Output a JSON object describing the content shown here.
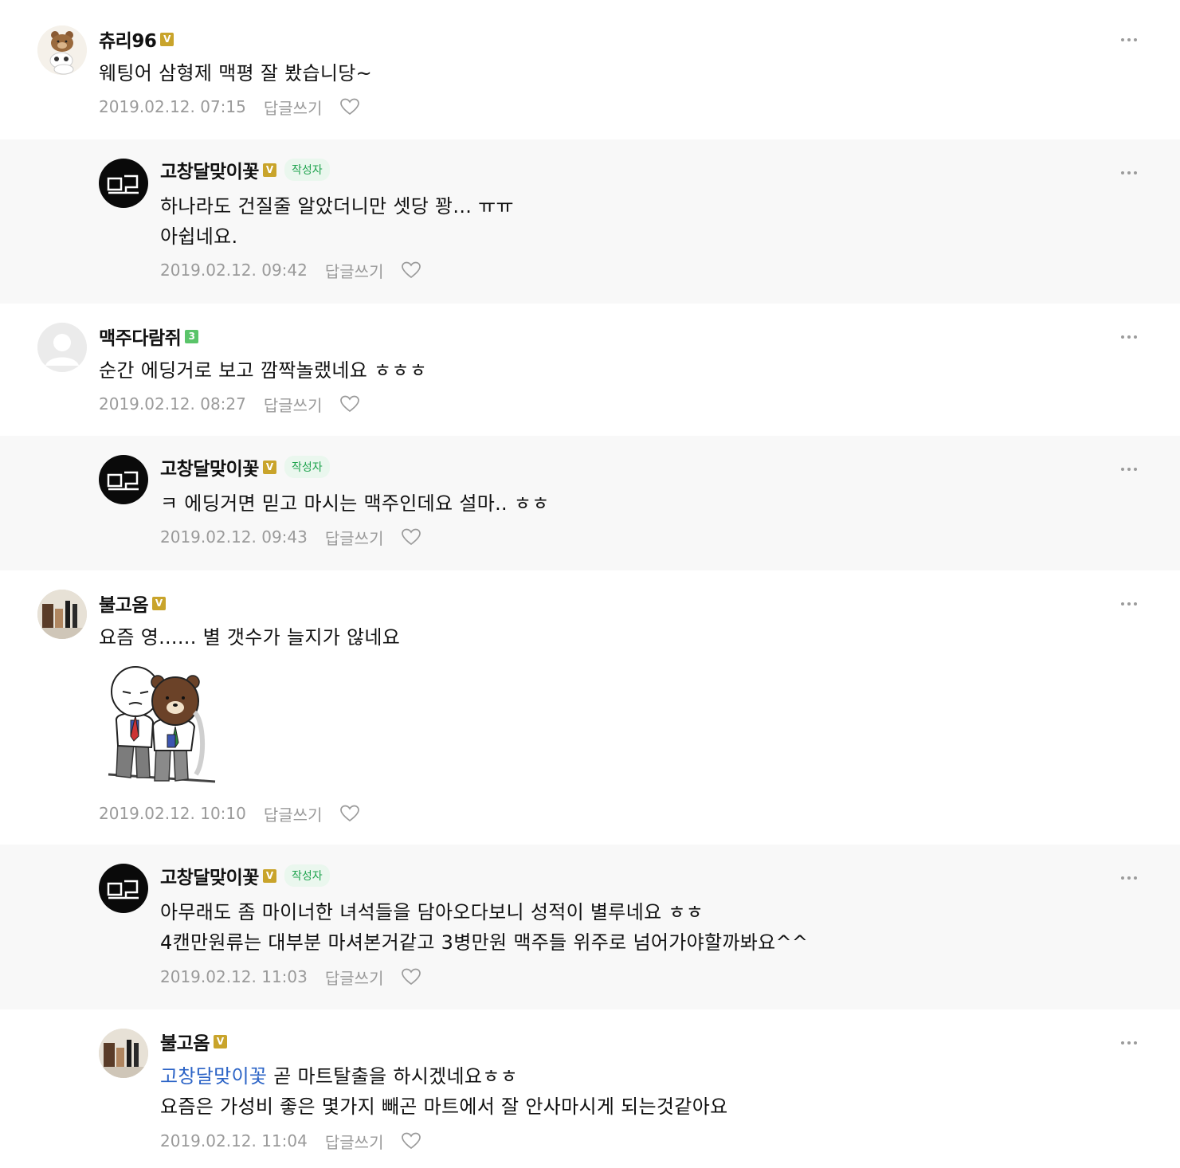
{
  "ui": {
    "author_label": "작성자",
    "reply_label": "답글쓰기",
    "more_icon": "more-dots-icon",
    "like_icon": "heart-icon"
  },
  "colors": {
    "badge_gold": "#c9a42b",
    "badge_green": "#5ac469",
    "author_tag_text": "#1fa34e",
    "mention": "#2b63c6",
    "reply_bg": "#f8f8f8"
  },
  "comments": [
    {
      "name": "츄리96",
      "badge": "V",
      "lines": [
        "웨팅어 삼형제 맥평 잘 봤습니당~"
      ],
      "date": "2019.02.12. 07:15"
    },
    {
      "name": "고창달맞이꽃",
      "badge": "V",
      "author": true,
      "lines": [
        "하나라도 건질줄 알았더니만 셋당 꽝... ㅠㅠ",
        "아쉽네요."
      ],
      "date": "2019.02.12. 09:42"
    },
    {
      "name": "맥주다람쥐",
      "badge": "3",
      "lines": [
        "순간 에딩거로 보고 깜짝놀랬네요 ㅎㅎㅎ"
      ],
      "date": "2019.02.12. 08:27"
    },
    {
      "name": "고창달맞이꽃",
      "badge": "V",
      "author": true,
      "lines": [
        "ㅋ 에딩거면 믿고 마시는 맥주인데요 설마.. ㅎㅎ"
      ],
      "date": "2019.02.12. 09:43"
    },
    {
      "name": "불고옴",
      "badge": "V",
      "lines": [
        "요즘 영...... 별 갯수가 늘지가 않네요"
      ],
      "date": "2019.02.12. 10:10"
    },
    {
      "name": "고창달맞이꽃",
      "badge": "V",
      "author": true,
      "lines": [
        "아무래도 좀 마이너한 녀석들을 담아오다보니 성적이 별루네요 ㅎㅎ",
        "4캔만원류는 대부분 마셔본거같고 3병만원 맥주들 위주로 넘어가야할까봐요^^"
      ],
      "date": "2019.02.12. 11:03"
    },
    {
      "name": "불고옴",
      "badge": "V",
      "mention": "고창달맞이꽃",
      "lines": [
        " 곧 마트탈출을 하시겠네요ㅎㅎ",
        "요즘은 가성비 좋은 몇가지 빼곤 마트에서 잘 안사마시게 되는것같아요"
      ],
      "date": "2019.02.12. 11:04"
    }
  ]
}
